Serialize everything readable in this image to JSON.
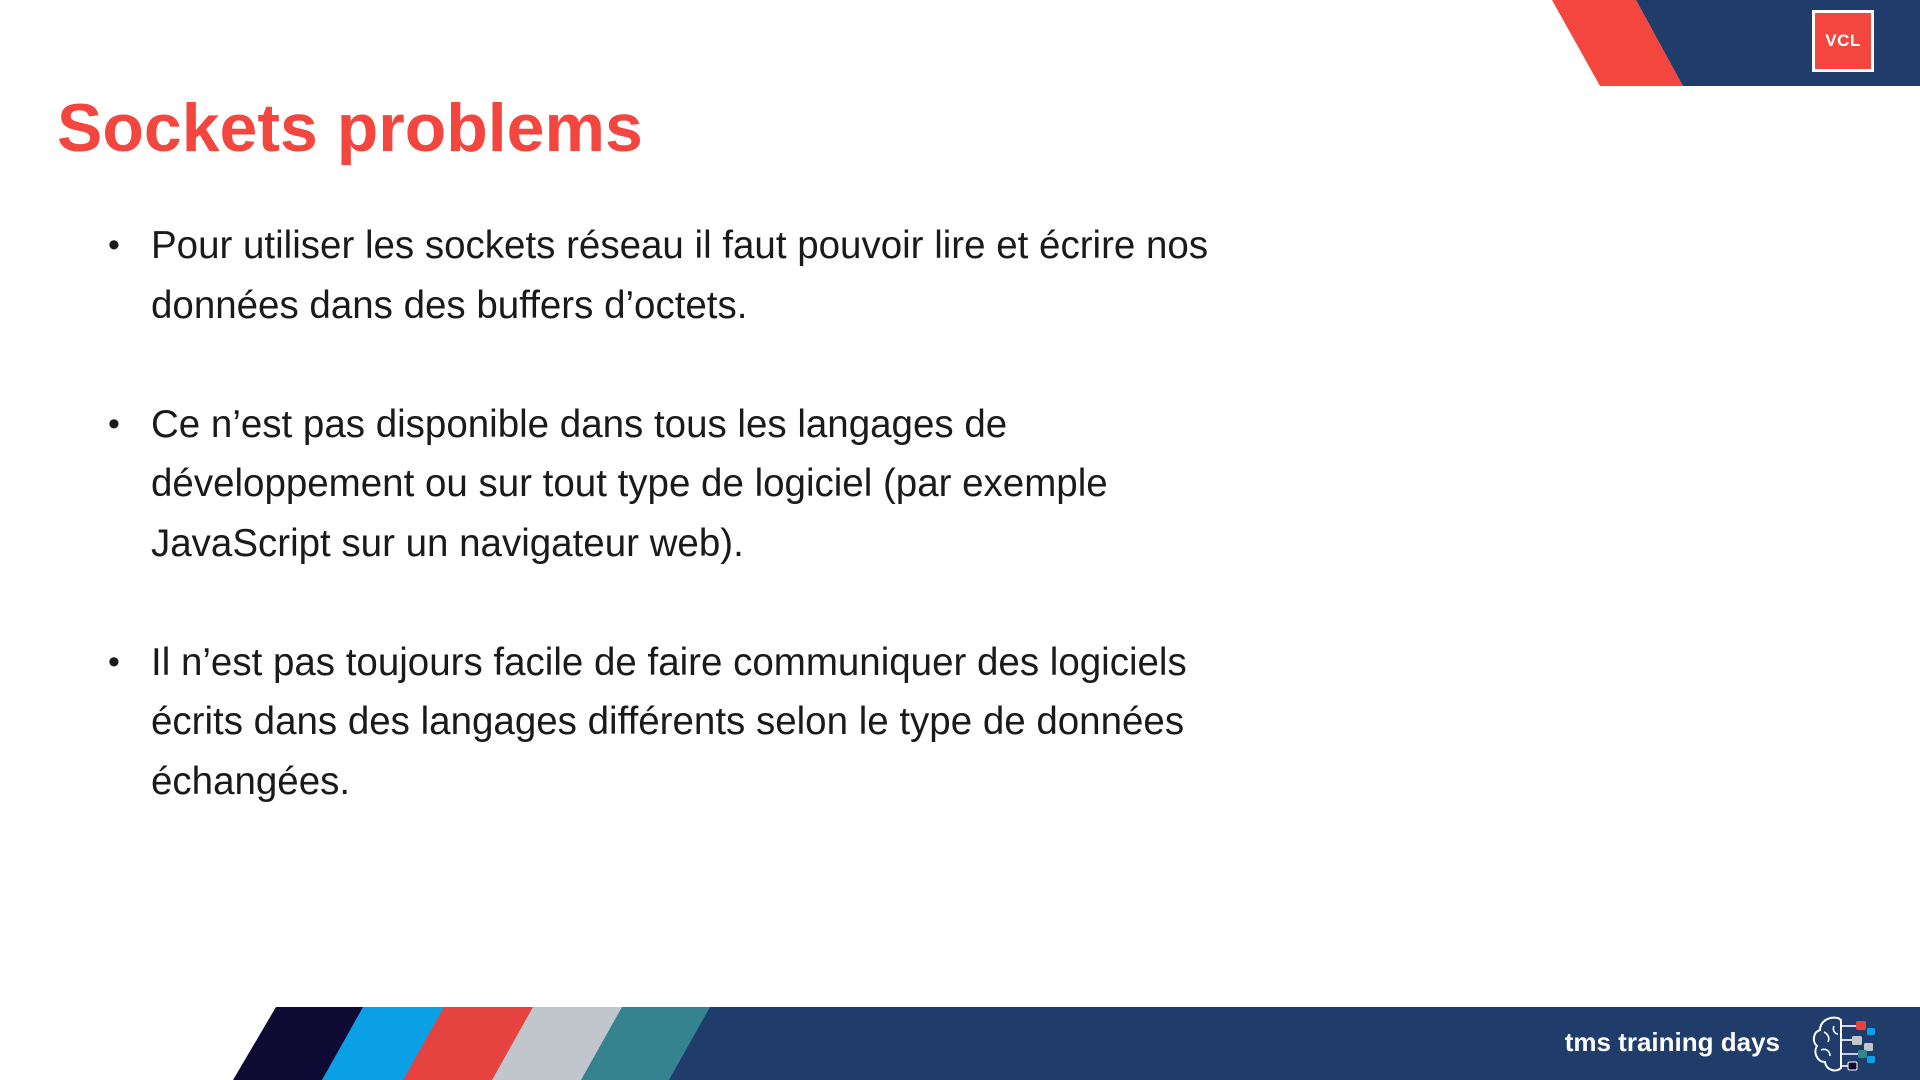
{
  "slide": {
    "title": "Sockets problems",
    "logo_text": "VCL",
    "bullets": [
      {
        "text": "Pour utiliser les sockets réseau il faut pouvoir lire et écrire nos données dans des buffers d’octets."
      },
      {
        "text": "Ce n’est pas disponible dans tous les langages de développement ou sur tout type de logiciel (par exemple JavaScript sur un navigateur web)."
      },
      {
        "text": "Il n’est pas toujours facile de faire communiquer des logiciels écrits dans des langages différents selon le type de données échangées."
      }
    ],
    "bullet_glyph": "•",
    "footer_text": "tms training days"
  },
  "colors": {
    "accent_red": "#f2463f",
    "navy": "#1f3c6b",
    "dark_navy": "#0e0a33",
    "blue": "#0aa0e6",
    "red_stripe": "#e5433f",
    "gray_stripe": "#c0c6cc",
    "teal_stripe": "#34838f",
    "text": "#1a1a1a"
  },
  "icons": {
    "logo": "vcl-logo-icon",
    "footer": "brain-circuit-icon"
  }
}
